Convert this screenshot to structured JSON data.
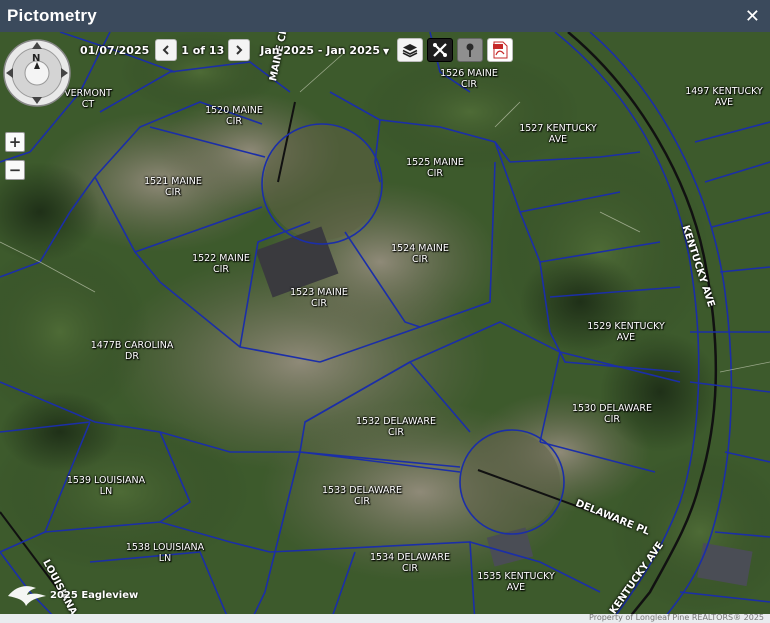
{
  "window": {
    "title": "Pictometry"
  },
  "toolbar": {
    "date": "01/07/2025",
    "page": "1 of 13",
    "range": "Jan 2025 - Jan 2025"
  },
  "parcels": [
    {
      "id": "vermont",
      "line1": "VERMONT",
      "line2": "CT"
    },
    {
      "id": "1520-maine",
      "line1": "1520 MAINE",
      "line2": "CIR"
    },
    {
      "id": "1526-maine",
      "line1": "1526 MAINE",
      "line2": "CIR"
    },
    {
      "id": "1497-kentucky",
      "line1": "1497 KENTUCKY",
      "line2": "AVE"
    },
    {
      "id": "1527-kentucky",
      "line1": "1527 KENTUCKY",
      "line2": "AVE"
    },
    {
      "id": "1525-maine",
      "line1": "1525 MAINE",
      "line2": "CIR"
    },
    {
      "id": "1521-maine",
      "line1": "1521 MAINE",
      "line2": "CIR"
    },
    {
      "id": "1522-maine",
      "line1": "1522 MAINE",
      "line2": "CIR"
    },
    {
      "id": "1524-maine",
      "line1": "1524 MAINE",
      "line2": "CIR"
    },
    {
      "id": "1523-maine",
      "line1": "1523 MAINE",
      "line2": "CIR"
    },
    {
      "id": "1477b-carolina",
      "line1": "1477B CAROLINA",
      "line2": "DR"
    },
    {
      "id": "1529-kentucky",
      "line1": "1529 KENTUCKY",
      "line2": "AVE"
    },
    {
      "id": "1530-delaware",
      "line1": "1530 DELAWARE",
      "line2": "CIR"
    },
    {
      "id": "1532-delaware",
      "line1": "1532 DELAWARE",
      "line2": "CIR"
    },
    {
      "id": "1539-louisiana",
      "line1": "1539 LOUISIANA",
      "line2": "LN"
    },
    {
      "id": "1533-delaware",
      "line1": "1533 DELAWARE",
      "line2": "CIR"
    },
    {
      "id": "1538-louisiana",
      "line1": "1538 LOUISIANA",
      "line2": "LN"
    },
    {
      "id": "1534-delaware",
      "line1": "1534 DELAWARE",
      "line2": "CIR"
    },
    {
      "id": "1535-kentucky",
      "line1": "1535 KENTUCKY",
      "line2": "AVE"
    }
  ],
  "streets": {
    "maine_cir": "MAINE CIR",
    "kentucky_ave_upper": "KENTUCKY AVE",
    "kentucky_ave_lower": "KENTUCKY AVE",
    "delaware_pl": "DELAWARE PL",
    "louisiana": "LOUISIANA"
  },
  "nav": {
    "north_label": "N"
  },
  "credit": {
    "text": "2025 Eagleview"
  },
  "footer": {
    "text": "Property of Longleaf Pine REALTORS® 2025"
  },
  "colors": {
    "titlebar": "#3b4a5c",
    "parcel_line": "#1b2ea8"
  }
}
